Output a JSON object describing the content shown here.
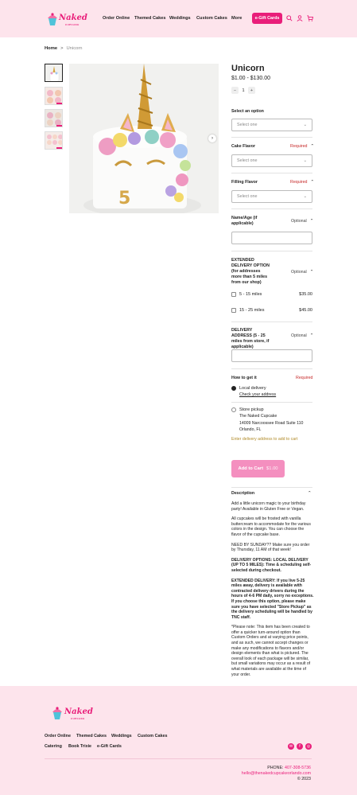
{
  "header": {
    "logo_word": "Naked",
    "logo_sub": "CUPCAKE",
    "nav": [
      "Order Online",
      "Themed Cakes",
      "Weddings",
      "Custom Cakes",
      "More"
    ],
    "gift_button": "e-Gift Cards"
  },
  "breadcrumb": {
    "home": "Home",
    "separator": ">",
    "current": "Unicorn"
  },
  "product": {
    "title": "Unicorn",
    "price": "$1.00 - $130.00",
    "qty_minus": "−",
    "qty_value": "1",
    "qty_plus": "+"
  },
  "options": {
    "select_option_label": "Select an option",
    "select_placeholder": "Select one",
    "cake_flavor_label": "Cake Flavor",
    "filling_flavor_label": "Filling Flavor",
    "required": "Required",
    "optional": "Optional",
    "name_age_label": "Name/Age (if applicable)",
    "extended_label": "EXTENDED DELIVERY OPTION (for addresses more than 5 miles from our shop)",
    "extended_options": [
      {
        "label": "5 - 15 miles",
        "price": "$35.00"
      },
      {
        "label": "15 - 25 miles",
        "price": "$45.00"
      }
    ],
    "delivery_address_label": "DELIVERY ADDRESS (5 - 25 miles from store, if applicable)",
    "how_to_get_label": "How to get it",
    "local_delivery": "Local delivery",
    "check_address": "Check your address",
    "store_pickup": "Store pickup",
    "store_name": "The Naked Cupcake",
    "store_street": "14009 Narcoossee Road Suite 110",
    "store_city": "Orlando, FL",
    "address_notice": "Enter delivery address to add to cart"
  },
  "cart": {
    "label": "Add to Cart",
    "price": "$1.00"
  },
  "description": {
    "title": "Description",
    "p1": "Add a little unicorn magic to your birthday party! Available in Gluten Free or Vegan.",
    "p2": "All cupcakes will be frosted with vanilla buttercream to accommodate for the various colors in the design. You can choose the flavor of the cupcake base.",
    "p3": "NEED BY SUNDAY?? Make sure you order by Thursday, 11 AM of that week!",
    "p4": "DELIVERY OPTIONS: LOCAL DELIVERY (UP TO 5 MILES): Time & scheduling self-selected during checkout.",
    "p5": "EXTENDED DELIVERY: If you live 5-25 miles away, delivery is available with contracted delivery drivers during the hours of 4-6 PM daily, sorry no exceptions. If you choose this option, please make sure you have selected \"Store Pickup\" as the delivery scheduling will be handled by TNC staff.",
    "p6": "*Please note: This item has been created to offer a quicker turn-around option than Custom Orders and at varying price points, and as such, we cannot accept changes or make any modifications to flavors and/or design elements than what is pictured. The overall look of each package will be similar, but small variations may occur as a result of what materials are available at the time of your order."
  },
  "footer": {
    "links_row1": [
      "Order Online",
      "Themed Cakes",
      "Weddings",
      "Custom Cakes"
    ],
    "links_row2": [
      "Catering",
      "Book Trixie",
      "e-Gift Cards"
    ],
    "phone_label": "PHONE:",
    "phone": "407-308-5736",
    "email": "hello@thenakedcupcakeorlando.com",
    "copyright": "© 2023"
  },
  "colors": {
    "brand_pink": "#e91e7a",
    "header_bg": "#fde4ec",
    "cart_pink": "#f48fbf",
    "required_red": "#c62828"
  }
}
